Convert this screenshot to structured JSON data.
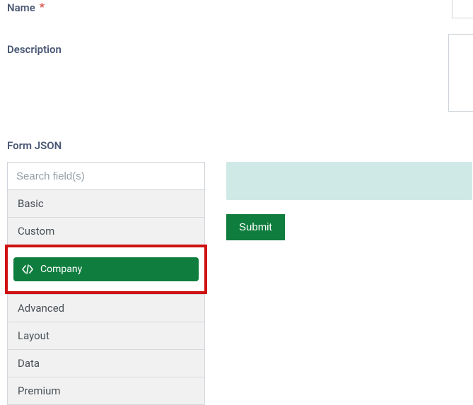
{
  "fields": {
    "name": {
      "label": "Name",
      "required_mark": "*"
    },
    "description": {
      "label": "Description"
    }
  },
  "section": {
    "form_json_label": "Form JSON"
  },
  "search": {
    "placeholder": "Search field(s)"
  },
  "panels": {
    "basic": "Basic",
    "custom": "Custom",
    "company_item": "Company",
    "advanced": "Advanced",
    "layout": "Layout",
    "data": "Data",
    "premium": "Premium"
  },
  "submit": {
    "label": "Submit"
  },
  "colors": {
    "accent_green": "#0f7d3e",
    "highlight_red": "#cf1111",
    "dropzone": "#cfe9e6"
  }
}
